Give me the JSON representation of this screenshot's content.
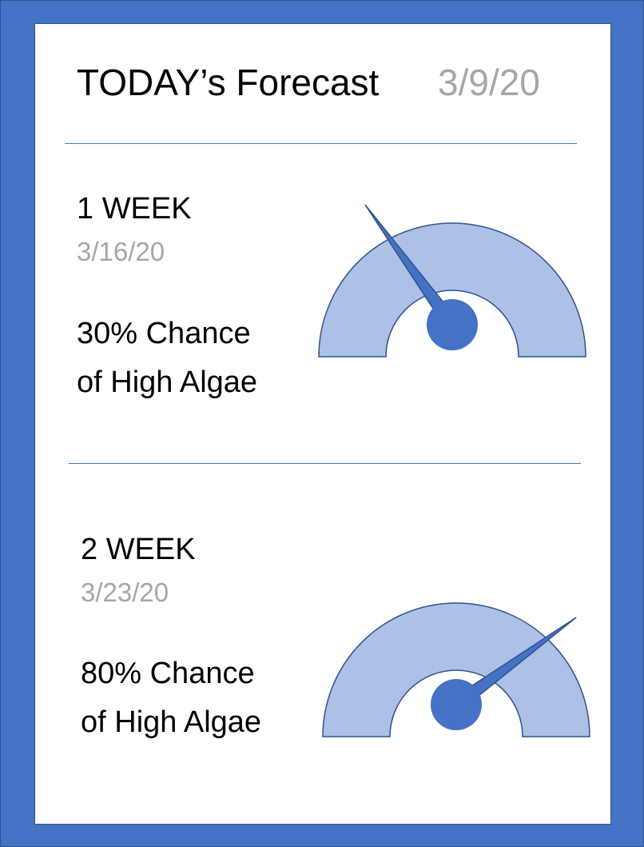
{
  "header": {
    "title": "TODAY’s Forecast",
    "date": "3/9/20"
  },
  "forecasts": [
    {
      "label": "1 WEEK",
      "date": "3/16/20",
      "chance_line": "30% Chance",
      "chance_suffix": "of High Algae",
      "chance_percent": 30
    },
    {
      "label": "2 WEEK",
      "date": "3/23/20",
      "chance_line": "80% Chance",
      "chance_suffix": "of High Algae",
      "chance_percent": 80
    }
  ],
  "colors": {
    "frame": "#4472c4",
    "gauge_fill": "#adc0e6",
    "gauge_stroke": "#2f528f",
    "needle": "#4472c4",
    "date_text": "#a6a6a6"
  },
  "icons": {
    "gauge": "speedometer-gauge-icon"
  }
}
